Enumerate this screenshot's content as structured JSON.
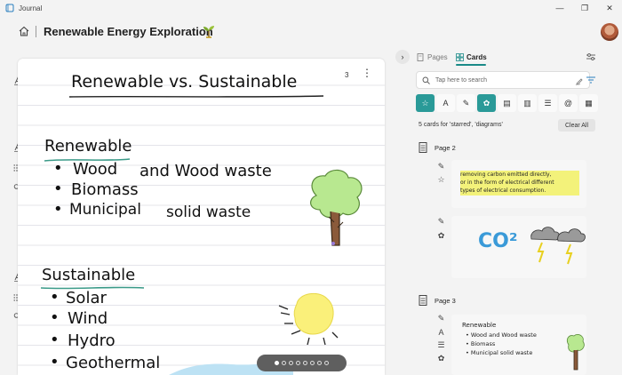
{
  "window": {
    "app_name": "Journal",
    "controls": {
      "minimize": "—",
      "restore": "❐",
      "close": "✕"
    }
  },
  "header": {
    "title": "Renewable Energy Exploration",
    "home_icon": "home-icon",
    "title_icon": "sprout-icon"
  },
  "canvas": {
    "page_count": "3",
    "more": "⋮",
    "heading": "Renewable vs. Sustainable",
    "section1": {
      "title": "Renewable",
      "items": [
        "Wood",
        "and Wood waste",
        "Biomass",
        "Municipal",
        "solid waste"
      ]
    },
    "section2": {
      "title": "Sustainable",
      "items": [
        "Solar",
        "Wind",
        "Hydro",
        "Geothermal"
      ]
    },
    "bullet": "•",
    "pager": {
      "dots": 8,
      "active": 0
    }
  },
  "panel": {
    "collapse": "›",
    "tabs": [
      {
        "label": "Pages",
        "icon": "pages-icon"
      },
      {
        "label": "Cards",
        "icon": "cards-icon",
        "active": true
      }
    ],
    "search": {
      "placeholder": "Tap here to search"
    },
    "filters": [
      {
        "icon": "star-icon",
        "glyph": "☆",
        "active": true
      },
      {
        "icon": "text-icon",
        "glyph": "A",
        "active": false
      },
      {
        "icon": "highlighter-icon",
        "glyph": "✎",
        "active": false
      },
      {
        "icon": "diagram-icon",
        "glyph": "✿",
        "active": true
      },
      {
        "icon": "pdf-icon",
        "glyph": "▤",
        "active": false
      },
      {
        "icon": "document-icon",
        "glyph": "▥",
        "active": false
      },
      {
        "icon": "list-icon",
        "glyph": "☰",
        "active": false
      },
      {
        "icon": "mention-icon",
        "glyph": "@",
        "active": false
      },
      {
        "icon": "calendar-icon",
        "glyph": "▦",
        "active": false
      }
    ],
    "result_text": "5 cards for 'starred', 'diagrams'",
    "clear_all": "Clear All",
    "sections": [
      {
        "label": "Page 2",
        "cards": [
          {
            "lines": [
              "removing carbon emitted directly,",
              "or in the form of electrical different",
              "types of electrical consumption."
            ]
          },
          {
            "text": "CO²"
          }
        ]
      },
      {
        "label": "Page 3",
        "cards": [
          {
            "lines": [
              "Renewable",
              "• Wood and Wood waste",
              "• Biomass",
              "• Municipal solid waste"
            ]
          }
        ]
      }
    ]
  },
  "colors": {
    "accent": "#2a9a98",
    "highlight": "#f3f27a",
    "underline": "#3a9a88"
  }
}
